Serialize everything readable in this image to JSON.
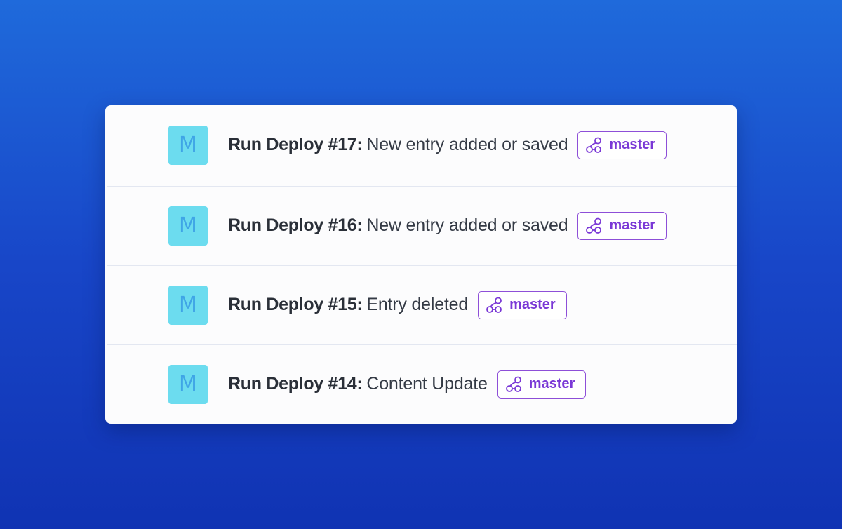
{
  "deploys": [
    {
      "avatar_letter": "M",
      "title": "Run Deploy #17:",
      "description": "New entry added or saved",
      "branch": "master",
      "branch_icon": "git-branch-icon"
    },
    {
      "avatar_letter": "M",
      "title": "Run Deploy #16:",
      "description": "New entry added or saved",
      "branch": "master",
      "branch_icon": "git-branch-icon"
    },
    {
      "avatar_letter": "M",
      "title": "Run Deploy #15:",
      "description": "Entry deleted",
      "branch": "master",
      "branch_icon": "git-branch-icon"
    },
    {
      "avatar_letter": "M",
      "title": "Run Deploy #14:",
      "description": "Content Update",
      "branch": "master",
      "branch_icon": "git-branch-icon"
    }
  ],
  "colors": {
    "background_top": "#1f6adb",
    "background_bottom": "#1033b3",
    "avatar_bg": "#6cdcef",
    "avatar_letter": "#3fa5e6",
    "branch_accent": "#7a38d6",
    "divider": "#e3e7f1"
  }
}
